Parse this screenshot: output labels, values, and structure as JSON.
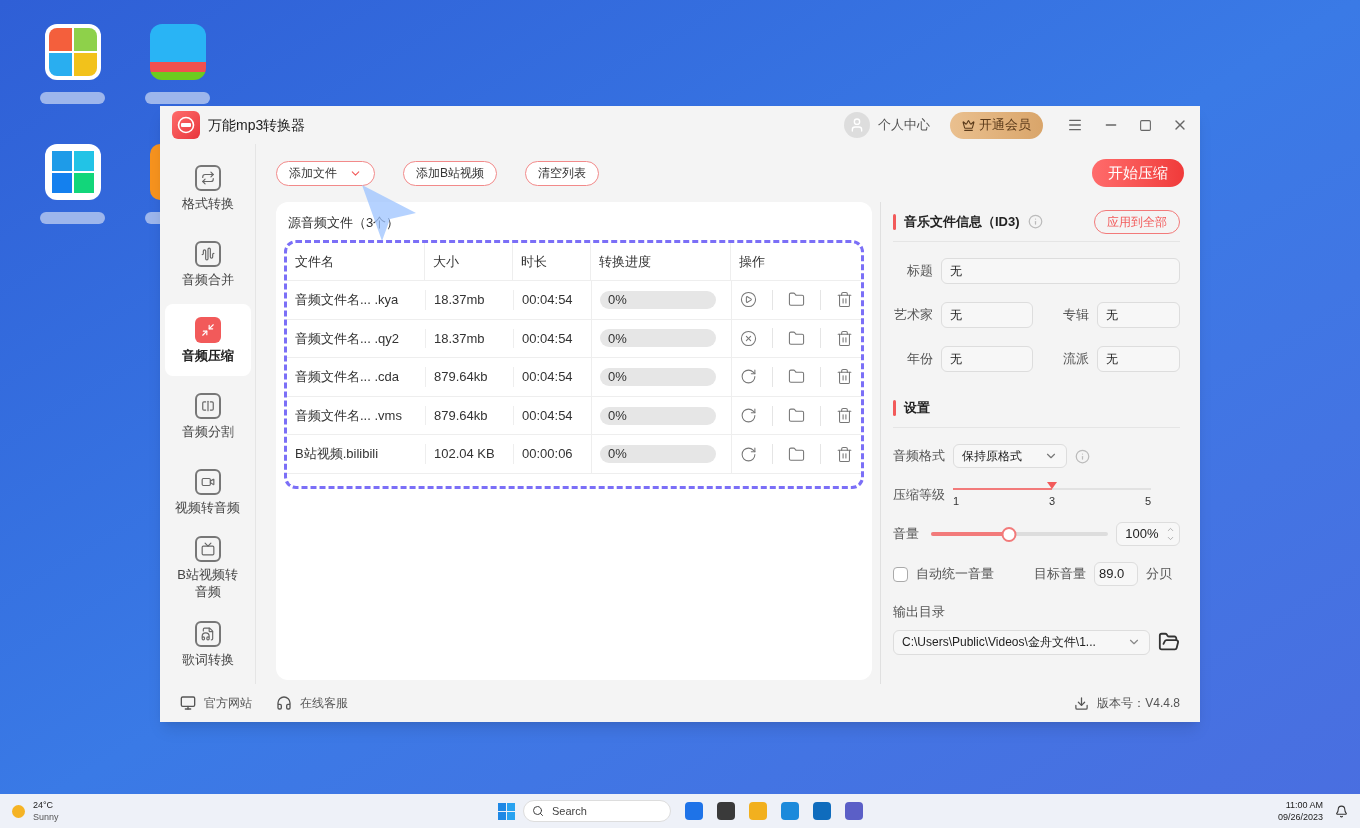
{
  "window": {
    "title": "万能mp3转换器",
    "user": "个人中心",
    "vip_button": "开通会员"
  },
  "toolbar": {
    "buttons": [
      {
        "label": "添加文件",
        "kind": "dropdown"
      },
      {
        "label": "添加B站视频",
        "kind": "plain"
      },
      {
        "label": "清空列表",
        "kind": "plain"
      }
    ],
    "start_button": "开始压缩"
  },
  "sidebar": {
    "items": [
      {
        "label": "格式转换",
        "kind": "convert",
        "selected": false
      },
      {
        "label": "音频合并",
        "kind": "merge",
        "selected": false
      },
      {
        "label": "音频压缩",
        "kind": "compress",
        "selected": true
      },
      {
        "label": "音频分割",
        "kind": "split",
        "selected": false
      },
      {
        "label": "视频转音频",
        "kind": "video",
        "selected": false
      },
      {
        "label": "B站视频转音频",
        "kind": "tv",
        "selected": false
      },
      {
        "label": "歌词转换",
        "kind": "lyrics",
        "selected": false
      }
    ]
  },
  "file_list": {
    "title": "源音频文件（3个）",
    "columns": [
      "文件名",
      "大小",
      "时长",
      "转换进度",
      "操作"
    ],
    "rows": [
      {
        "name": "音频文件名... .kya",
        "size": "18.37mb",
        "duration": "00:04:54",
        "progress": "0%",
        "level": 0,
        "kind": "play"
      },
      {
        "name": "音频文件名... .qy2",
        "size": "18.37mb",
        "duration": "00:04:54",
        "progress": "0%",
        "level": 0,
        "kind": "cancel"
      },
      {
        "name": "音频文件名... .cda",
        "size": "879.64kb",
        "duration": "00:04:54",
        "progress": "0%",
        "level": 0,
        "kind": "retry"
      },
      {
        "name": "音频文件名... .vms",
        "size": "879.64kb",
        "duration": "00:04:54",
        "progress": "0%",
        "level": 0,
        "kind": "retry"
      },
      {
        "name": "B站视频.bilibili",
        "size": "102.04 KB",
        "duration": "00:00:06",
        "progress": "0%",
        "level": 0,
        "kind": "retry"
      }
    ]
  },
  "id3": {
    "title": "音乐文件信息（ID3)",
    "apply_button": "应用到全部",
    "fields": [
      {
        "label": "标题",
        "value": "无",
        "kind": "wide"
      },
      {
        "label": "艺术家",
        "value": "无",
        "kind": "half"
      },
      {
        "label": "专辑",
        "value": "无",
        "kind": "half"
      },
      {
        "label": "年份",
        "value": "无",
        "kind": "half"
      },
      {
        "label": "流派",
        "value": "无",
        "kind": "half"
      }
    ]
  },
  "settings": {
    "title": "设置",
    "format_label": "音频格式",
    "format_value": "保持原格式",
    "compression": {
      "label": "压缩等级",
      "ticks": [
        "1",
        "3",
        "5"
      ],
      "level": 0.5
    },
    "volume": {
      "label": "音量",
      "level": 0.44,
      "value": "100%"
    },
    "auto_volume": {
      "label": "自动统一音量",
      "checked": false
    },
    "target_label": "目标音量",
    "target_value": "89.0",
    "target_unit": "分贝",
    "output_label": "输出目录",
    "output_path": "C:\\Users\\Public\\Videos\\金舟文件\\1..."
  },
  "footer": {
    "links": [
      "官方网站",
      "在线客服"
    ],
    "version": "版本号：V4.4.8"
  },
  "taskbar": {
    "weather_temp": "24°C",
    "weather_text": "Sunny",
    "search_placeholder": "Search",
    "time": "11:00 AM",
    "date": "09/26/2023"
  }
}
